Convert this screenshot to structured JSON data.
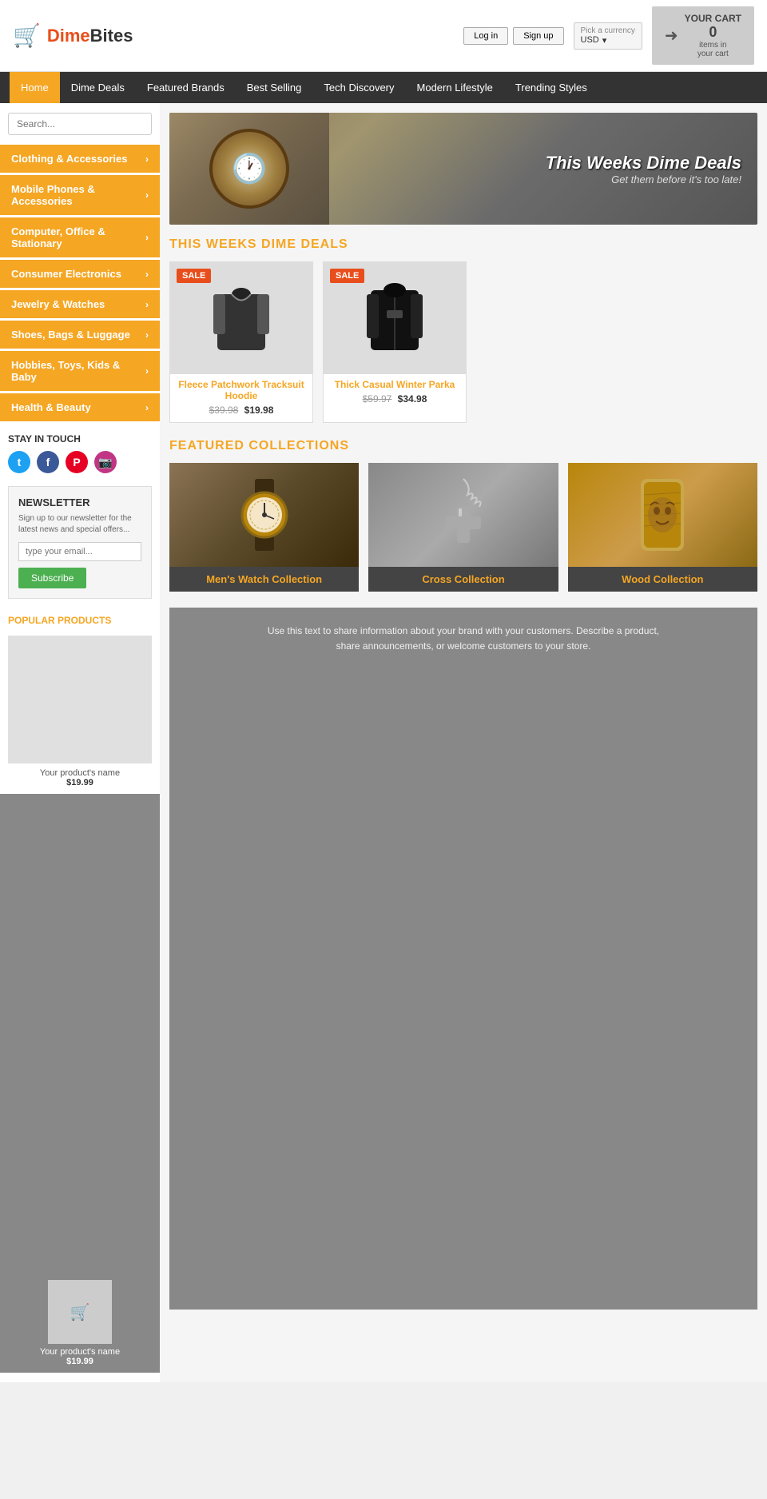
{
  "site": {
    "name_part1": "Dime",
    "name_part2": "Bites"
  },
  "topbar": {
    "login_label": "Log in",
    "signup_label": "Sign up",
    "currency_label": "Pick a currency",
    "currency_value": "USD",
    "cart_label": "YOUR CART",
    "cart_count": "0",
    "cart_items_text": "items in",
    "cart_your_cart": "your cart"
  },
  "nav": {
    "items": [
      {
        "label": "Home",
        "active": true
      },
      {
        "label": "Dime Deals",
        "active": false
      },
      {
        "label": "Featured Brands",
        "active": false
      },
      {
        "label": "Best Selling",
        "active": false
      },
      {
        "label": "Tech Discovery",
        "active": false
      },
      {
        "label": "Modern Lifestyle",
        "active": false
      },
      {
        "label": "Trending Styles",
        "active": false
      }
    ]
  },
  "sidebar": {
    "search_placeholder": "Search...",
    "categories": [
      {
        "label": "Clothing & Accessories"
      },
      {
        "label": "Mobile Phones & Accessories"
      },
      {
        "label": "Computer, Office & Stationary"
      },
      {
        "label": "Consumer Electronics"
      },
      {
        "label": "Jewelry & Watches"
      },
      {
        "label": "Shoes, Bags & Luggage"
      },
      {
        "label": "Hobbies, Toys, Kids & Baby"
      },
      {
        "label": "Health & Beauty"
      }
    ],
    "stay_in_touch": "STAY IN TOUCH",
    "newsletter": {
      "title": "NEWSLETTER",
      "description": "Sign up to our newsletter for the latest news and special offers...",
      "input_placeholder": "type your email...",
      "button_label": "Subscribe"
    },
    "popular_title": "POPULAR PRODUCTS",
    "popular_products": [
      {
        "name": "Your product's name",
        "price": "$19.99"
      },
      {
        "name": "Your product's name",
        "price": "$19.99"
      }
    ]
  },
  "hero": {
    "title": "This Weeks Dime Deals",
    "subtitle": "Get them before it's too late!"
  },
  "deals_section": {
    "title": "THIS WEEKS DIME DEALS",
    "products": [
      {
        "name": "Fleece Patchwork Tracksuit Hoodie",
        "old_price": "$39.98",
        "new_price": "$19.98",
        "sale": true
      },
      {
        "name": "Thick Casual Winter Parka",
        "old_price": "$59.97",
        "new_price": "$34.98",
        "sale": true
      }
    ]
  },
  "collections_section": {
    "title": "FEATURED COLLECTIONS",
    "items": [
      {
        "label": "Men's Watch Collection",
        "icon": "⌚"
      },
      {
        "label": "Cross Collection",
        "icon": "✝"
      },
      {
        "label": "Wood Collection",
        "icon": "📱"
      }
    ]
  },
  "info_text": {
    "line1": "Use this text to share information about your brand with your customers. Describe a product,",
    "line2": "share announcements, or welcome customers to your store."
  }
}
